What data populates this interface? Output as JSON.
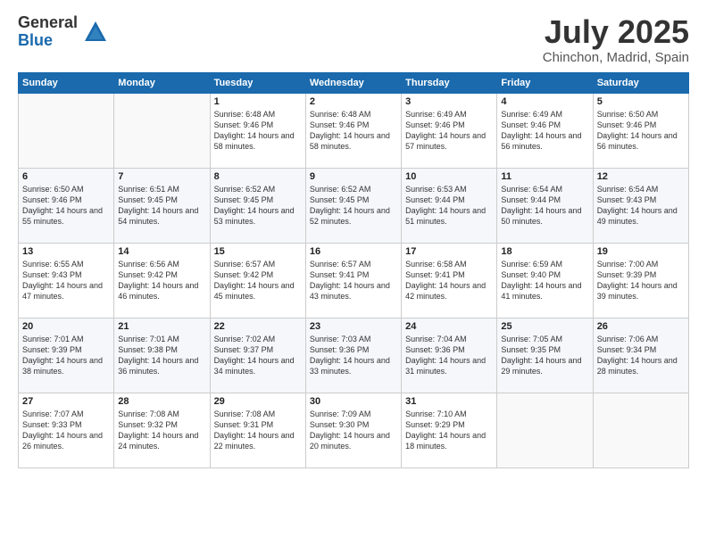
{
  "header": {
    "logo_general": "General",
    "logo_blue": "Blue",
    "title": "July 2025",
    "subtitle": "Chinchon, Madrid, Spain"
  },
  "days_of_week": [
    "Sunday",
    "Monday",
    "Tuesday",
    "Wednesday",
    "Thursday",
    "Friday",
    "Saturday"
  ],
  "weeks": [
    [
      {
        "day": "",
        "info": ""
      },
      {
        "day": "",
        "info": ""
      },
      {
        "day": "1",
        "info": "Sunrise: 6:48 AM\nSunset: 9:46 PM\nDaylight: 14 hours and 58 minutes."
      },
      {
        "day": "2",
        "info": "Sunrise: 6:48 AM\nSunset: 9:46 PM\nDaylight: 14 hours and 58 minutes."
      },
      {
        "day": "3",
        "info": "Sunrise: 6:49 AM\nSunset: 9:46 PM\nDaylight: 14 hours and 57 minutes."
      },
      {
        "day": "4",
        "info": "Sunrise: 6:49 AM\nSunset: 9:46 PM\nDaylight: 14 hours and 56 minutes."
      },
      {
        "day": "5",
        "info": "Sunrise: 6:50 AM\nSunset: 9:46 PM\nDaylight: 14 hours and 56 minutes."
      }
    ],
    [
      {
        "day": "6",
        "info": "Sunrise: 6:50 AM\nSunset: 9:46 PM\nDaylight: 14 hours and 55 minutes."
      },
      {
        "day": "7",
        "info": "Sunrise: 6:51 AM\nSunset: 9:45 PM\nDaylight: 14 hours and 54 minutes."
      },
      {
        "day": "8",
        "info": "Sunrise: 6:52 AM\nSunset: 9:45 PM\nDaylight: 14 hours and 53 minutes."
      },
      {
        "day": "9",
        "info": "Sunrise: 6:52 AM\nSunset: 9:45 PM\nDaylight: 14 hours and 52 minutes."
      },
      {
        "day": "10",
        "info": "Sunrise: 6:53 AM\nSunset: 9:44 PM\nDaylight: 14 hours and 51 minutes."
      },
      {
        "day": "11",
        "info": "Sunrise: 6:54 AM\nSunset: 9:44 PM\nDaylight: 14 hours and 50 minutes."
      },
      {
        "day": "12",
        "info": "Sunrise: 6:54 AM\nSunset: 9:43 PM\nDaylight: 14 hours and 49 minutes."
      }
    ],
    [
      {
        "day": "13",
        "info": "Sunrise: 6:55 AM\nSunset: 9:43 PM\nDaylight: 14 hours and 47 minutes."
      },
      {
        "day": "14",
        "info": "Sunrise: 6:56 AM\nSunset: 9:42 PM\nDaylight: 14 hours and 46 minutes."
      },
      {
        "day": "15",
        "info": "Sunrise: 6:57 AM\nSunset: 9:42 PM\nDaylight: 14 hours and 45 minutes."
      },
      {
        "day": "16",
        "info": "Sunrise: 6:57 AM\nSunset: 9:41 PM\nDaylight: 14 hours and 43 minutes."
      },
      {
        "day": "17",
        "info": "Sunrise: 6:58 AM\nSunset: 9:41 PM\nDaylight: 14 hours and 42 minutes."
      },
      {
        "day": "18",
        "info": "Sunrise: 6:59 AM\nSunset: 9:40 PM\nDaylight: 14 hours and 41 minutes."
      },
      {
        "day": "19",
        "info": "Sunrise: 7:00 AM\nSunset: 9:39 PM\nDaylight: 14 hours and 39 minutes."
      }
    ],
    [
      {
        "day": "20",
        "info": "Sunrise: 7:01 AM\nSunset: 9:39 PM\nDaylight: 14 hours and 38 minutes."
      },
      {
        "day": "21",
        "info": "Sunrise: 7:01 AM\nSunset: 9:38 PM\nDaylight: 14 hours and 36 minutes."
      },
      {
        "day": "22",
        "info": "Sunrise: 7:02 AM\nSunset: 9:37 PM\nDaylight: 14 hours and 34 minutes."
      },
      {
        "day": "23",
        "info": "Sunrise: 7:03 AM\nSunset: 9:36 PM\nDaylight: 14 hours and 33 minutes."
      },
      {
        "day": "24",
        "info": "Sunrise: 7:04 AM\nSunset: 9:36 PM\nDaylight: 14 hours and 31 minutes."
      },
      {
        "day": "25",
        "info": "Sunrise: 7:05 AM\nSunset: 9:35 PM\nDaylight: 14 hours and 29 minutes."
      },
      {
        "day": "26",
        "info": "Sunrise: 7:06 AM\nSunset: 9:34 PM\nDaylight: 14 hours and 28 minutes."
      }
    ],
    [
      {
        "day": "27",
        "info": "Sunrise: 7:07 AM\nSunset: 9:33 PM\nDaylight: 14 hours and 26 minutes."
      },
      {
        "day": "28",
        "info": "Sunrise: 7:08 AM\nSunset: 9:32 PM\nDaylight: 14 hours and 24 minutes."
      },
      {
        "day": "29",
        "info": "Sunrise: 7:08 AM\nSunset: 9:31 PM\nDaylight: 14 hours and 22 minutes."
      },
      {
        "day": "30",
        "info": "Sunrise: 7:09 AM\nSunset: 9:30 PM\nDaylight: 14 hours and 20 minutes."
      },
      {
        "day": "31",
        "info": "Sunrise: 7:10 AM\nSunset: 9:29 PM\nDaylight: 14 hours and 18 minutes."
      },
      {
        "day": "",
        "info": ""
      },
      {
        "day": "",
        "info": ""
      }
    ]
  ]
}
